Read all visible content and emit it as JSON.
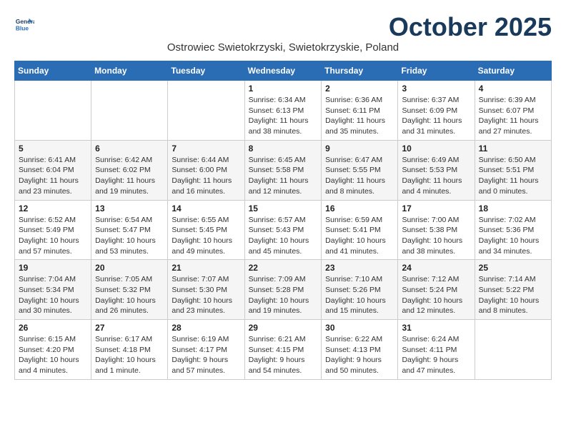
{
  "header": {
    "logo_line1": "General",
    "logo_line2": "Blue",
    "month_title": "October 2025",
    "location": "Ostrowiec Swietokrzyski, Swietokrzyskie, Poland"
  },
  "weekdays": [
    "Sunday",
    "Monday",
    "Tuesday",
    "Wednesday",
    "Thursday",
    "Friday",
    "Saturday"
  ],
  "weeks": [
    [
      {
        "day": "",
        "info": ""
      },
      {
        "day": "",
        "info": ""
      },
      {
        "day": "",
        "info": ""
      },
      {
        "day": "1",
        "info": "Sunrise: 6:34 AM\nSunset: 6:13 PM\nDaylight: 11 hours\nand 38 minutes."
      },
      {
        "day": "2",
        "info": "Sunrise: 6:36 AM\nSunset: 6:11 PM\nDaylight: 11 hours\nand 35 minutes."
      },
      {
        "day": "3",
        "info": "Sunrise: 6:37 AM\nSunset: 6:09 PM\nDaylight: 11 hours\nand 31 minutes."
      },
      {
        "day": "4",
        "info": "Sunrise: 6:39 AM\nSunset: 6:07 PM\nDaylight: 11 hours\nand 27 minutes."
      }
    ],
    [
      {
        "day": "5",
        "info": "Sunrise: 6:41 AM\nSunset: 6:04 PM\nDaylight: 11 hours\nand 23 minutes."
      },
      {
        "day": "6",
        "info": "Sunrise: 6:42 AM\nSunset: 6:02 PM\nDaylight: 11 hours\nand 19 minutes."
      },
      {
        "day": "7",
        "info": "Sunrise: 6:44 AM\nSunset: 6:00 PM\nDaylight: 11 hours\nand 16 minutes."
      },
      {
        "day": "8",
        "info": "Sunrise: 6:45 AM\nSunset: 5:58 PM\nDaylight: 11 hours\nand 12 minutes."
      },
      {
        "day": "9",
        "info": "Sunrise: 6:47 AM\nSunset: 5:55 PM\nDaylight: 11 hours\nand 8 minutes."
      },
      {
        "day": "10",
        "info": "Sunrise: 6:49 AM\nSunset: 5:53 PM\nDaylight: 11 hours\nand 4 minutes."
      },
      {
        "day": "11",
        "info": "Sunrise: 6:50 AM\nSunset: 5:51 PM\nDaylight: 11 hours\nand 0 minutes."
      }
    ],
    [
      {
        "day": "12",
        "info": "Sunrise: 6:52 AM\nSunset: 5:49 PM\nDaylight: 10 hours\nand 57 minutes."
      },
      {
        "day": "13",
        "info": "Sunrise: 6:54 AM\nSunset: 5:47 PM\nDaylight: 10 hours\nand 53 minutes."
      },
      {
        "day": "14",
        "info": "Sunrise: 6:55 AM\nSunset: 5:45 PM\nDaylight: 10 hours\nand 49 minutes."
      },
      {
        "day": "15",
        "info": "Sunrise: 6:57 AM\nSunset: 5:43 PM\nDaylight: 10 hours\nand 45 minutes."
      },
      {
        "day": "16",
        "info": "Sunrise: 6:59 AM\nSunset: 5:41 PM\nDaylight: 10 hours\nand 41 minutes."
      },
      {
        "day": "17",
        "info": "Sunrise: 7:00 AM\nSunset: 5:38 PM\nDaylight: 10 hours\nand 38 minutes."
      },
      {
        "day": "18",
        "info": "Sunrise: 7:02 AM\nSunset: 5:36 PM\nDaylight: 10 hours\nand 34 minutes."
      }
    ],
    [
      {
        "day": "19",
        "info": "Sunrise: 7:04 AM\nSunset: 5:34 PM\nDaylight: 10 hours\nand 30 minutes."
      },
      {
        "day": "20",
        "info": "Sunrise: 7:05 AM\nSunset: 5:32 PM\nDaylight: 10 hours\nand 26 minutes."
      },
      {
        "day": "21",
        "info": "Sunrise: 7:07 AM\nSunset: 5:30 PM\nDaylight: 10 hours\nand 23 minutes."
      },
      {
        "day": "22",
        "info": "Sunrise: 7:09 AM\nSunset: 5:28 PM\nDaylight: 10 hours\nand 19 minutes."
      },
      {
        "day": "23",
        "info": "Sunrise: 7:10 AM\nSunset: 5:26 PM\nDaylight: 10 hours\nand 15 minutes."
      },
      {
        "day": "24",
        "info": "Sunrise: 7:12 AM\nSunset: 5:24 PM\nDaylight: 10 hours\nand 12 minutes."
      },
      {
        "day": "25",
        "info": "Sunrise: 7:14 AM\nSunset: 5:22 PM\nDaylight: 10 hours\nand 8 minutes."
      }
    ],
    [
      {
        "day": "26",
        "info": "Sunrise: 6:15 AM\nSunset: 4:20 PM\nDaylight: 10 hours\nand 4 minutes."
      },
      {
        "day": "27",
        "info": "Sunrise: 6:17 AM\nSunset: 4:18 PM\nDaylight: 10 hours\nand 1 minute."
      },
      {
        "day": "28",
        "info": "Sunrise: 6:19 AM\nSunset: 4:17 PM\nDaylight: 9 hours\nand 57 minutes."
      },
      {
        "day": "29",
        "info": "Sunrise: 6:21 AM\nSunset: 4:15 PM\nDaylight: 9 hours\nand 54 minutes."
      },
      {
        "day": "30",
        "info": "Sunrise: 6:22 AM\nSunset: 4:13 PM\nDaylight: 9 hours\nand 50 minutes."
      },
      {
        "day": "31",
        "info": "Sunrise: 6:24 AM\nSunset: 4:11 PM\nDaylight: 9 hours\nand 47 minutes."
      },
      {
        "day": "",
        "info": ""
      }
    ]
  ]
}
